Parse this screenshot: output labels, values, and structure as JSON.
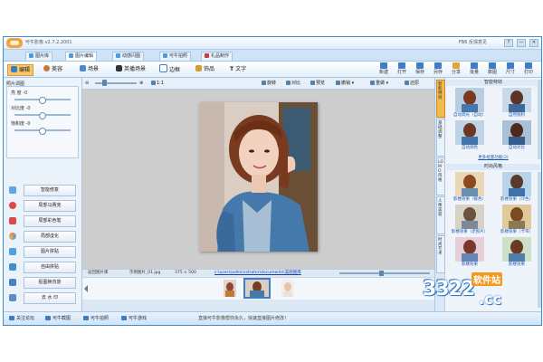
{
  "app": {
    "title": "可牛影像 v2.7.2.2001",
    "title_right": "FB6 反馈意见",
    "win_controls": [
      "?",
      "—",
      "✕"
    ]
  },
  "top_tabs": [
    "图片库",
    "图片编辑",
    "动感闪图",
    "可牛拍照",
    "礼品制作"
  ],
  "feature_tabs": [
    {
      "label": "编辑",
      "icon": "edit-icon",
      "active": true
    },
    {
      "label": "美容",
      "icon": "face-icon"
    },
    {
      "label": "场景",
      "icon": "scene-icon"
    },
    {
      "label": "英播场景",
      "icon": "camera-icon"
    },
    {
      "label": "边框",
      "icon": "frame-icon"
    },
    {
      "label": "饰品",
      "icon": "accessory-icon"
    },
    {
      "label": "文字",
      "icon": "text-icon"
    }
  ],
  "right_tools": [
    "新建",
    "打开",
    "保存",
    "另存",
    "分享",
    "批量",
    "数图",
    "尺寸",
    "打印"
  ],
  "left_panel": {
    "header": "照片调图",
    "sliders": [
      {
        "label": "亮 度",
        "value": "0",
        "level": 0.5
      },
      {
        "label": "对比度",
        "value": "0",
        "level": 0.5
      },
      {
        "label": "饱和度",
        "value": "0",
        "level": 0.5
      }
    ],
    "buttons": [
      {
        "label": "智能修复",
        "color": "#5aa6e0"
      },
      {
        "label": "局部马赛克",
        "color": "#e04848"
      },
      {
        "label": "局部彩色笔",
        "color": "#d94a4a"
      },
      {
        "label": "局部虚化",
        "color": "#e86f2c"
      },
      {
        "label": "图片拼贴",
        "color": "#4fa3d8"
      },
      {
        "label": "自由拼贴",
        "color": "#3f8fcf"
      },
      {
        "label": "抠图换背景",
        "color": "#4e7fc1"
      },
      {
        "label": "去 水 印",
        "color": "#5c8cc8"
      }
    ]
  },
  "subtoolbar": {
    "ratio": "1:1",
    "items": [
      "旋转",
      "对比",
      "预览",
      "撤销",
      "重做",
      "还原"
    ]
  },
  "pathbar": {
    "tab": "返回图片库",
    "filename": "示例图片_01.jpg",
    "size": "375 × 500",
    "path": "c:\\users\\administrator\\documents\\美图图库"
  },
  "right_panel": {
    "vtabs": [
      "智能特效",
      "基础调整",
      "LOMO风格",
      "人像美容",
      "时尚艺术"
    ],
    "section1": "智能特效",
    "section1_items": [
      "自动调光（自动）",
      "自然锐利",
      "自动调色",
      "自动对比"
    ],
    "link": "更多批量功能(2)",
    "section2": "时尚风格",
    "section2_items": [
      "影楼效果（暖色）",
      "影楼效果（冷色）",
      "影楼效果（老照片）",
      "影楼效果（卡带）",
      "影楼效果",
      "影楼效果"
    ]
  },
  "status": {
    "items": [
      "关注论坛",
      "可牛截图",
      "可牛拍照",
      "可牛游戏"
    ],
    "message": "直接可牛影像帮你永久，快速直接图片修改！",
    "watermark": {
      "main": "3322",
      "badge": "软件站",
      "cc": ".cc"
    }
  }
}
